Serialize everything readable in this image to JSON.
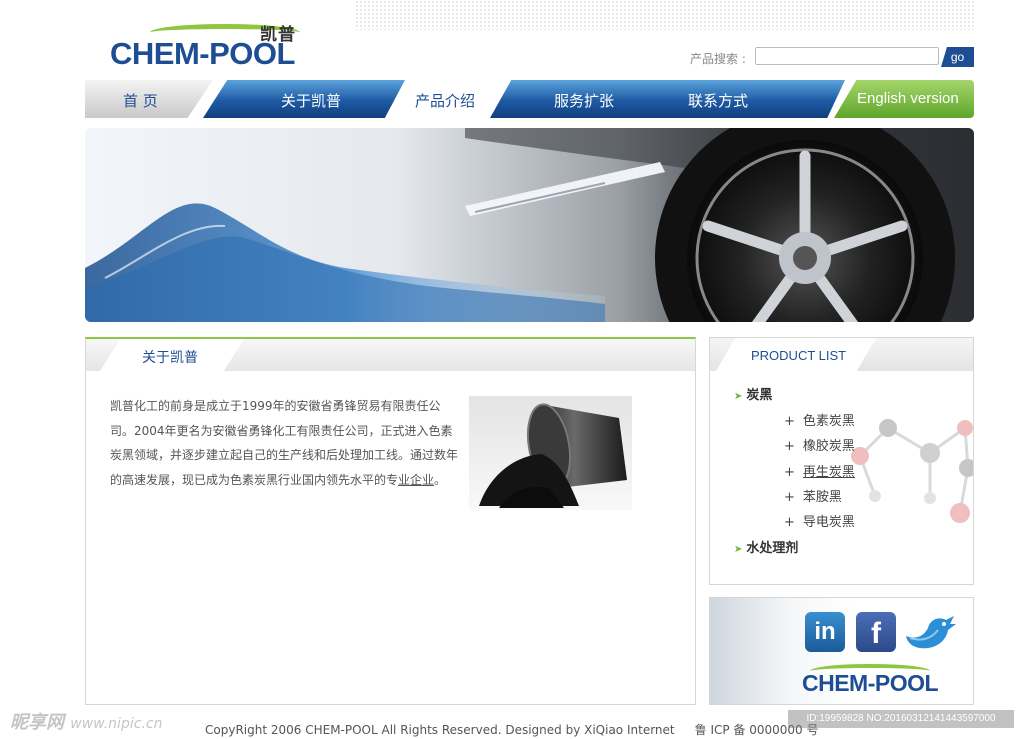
{
  "brand": {
    "name_cn": "凯普",
    "name_en": "CHEM-POOL",
    "colors": {
      "primary": "#1d4e93",
      "accent": "#8dc63f"
    }
  },
  "search": {
    "label": "产品搜索 :",
    "value": "",
    "placeholder": "",
    "button_label": "go"
  },
  "nav": {
    "items": [
      {
        "label": "首 页"
      },
      {
        "label": "关于凯普"
      },
      {
        "label": "产品介绍"
      },
      {
        "label": "服务扩张"
      },
      {
        "label": "联系方式"
      },
      {
        "label": "English version"
      }
    ]
  },
  "about": {
    "title": "关于凯普",
    "text_main": "凯普化工的前身是成立于1999年的安徽省勇锋贸易有限责任公司。2004年更名为安徽省勇锋化工有限责任公司，正式进入色素炭黑领域，并逐步建立起自己的生产线和后处理加工线。通过数年的高速发展，现已成为色素炭黑行业国内领先水平的专",
    "text_tail": "业企业",
    "text_end": "。"
  },
  "product_list": {
    "title": "PRODUCT LIST",
    "categories": [
      {
        "name": "炭黑",
        "items": [
          "色素炭黑",
          "橡胶炭黑",
          "再生炭黑",
          "苯胺黑",
          "导电炭黑"
        ]
      },
      {
        "name": "水处理剂",
        "items": []
      }
    ]
  },
  "social": {
    "icons": [
      "linkedin-icon",
      "facebook-icon",
      "twitter-bird-icon"
    ],
    "linkedin_glyph": "in",
    "facebook_glyph": "f",
    "logo_text": "CHEM-POOL"
  },
  "footer": {
    "copyright": "CopyRight 2006 CHEM-POOL All Rights Reserved.  Designed by XiQiao Internet",
    "icp": "鲁 ICP 备 0000000 号"
  },
  "watermark": {
    "site": "昵享网",
    "url": "www.nipic.cn",
    "id_text": "ID:19959828 NO:20160312141443597000"
  }
}
